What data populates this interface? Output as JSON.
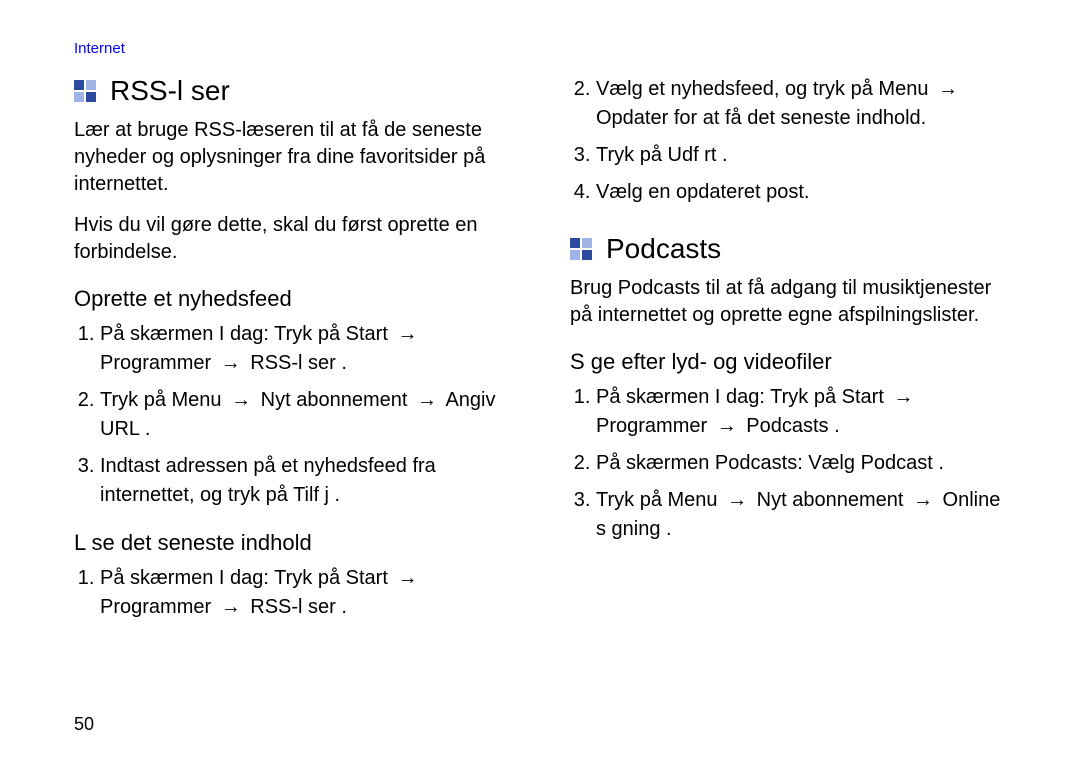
{
  "topcat": "Internet",
  "page_number": "50",
  "arrow": "→",
  "left": {
    "heading": "RSS-l ser",
    "intro1": "Lær at bruge RSS-læseren til at få de seneste nyheder og oplysninger fra dine favoritsider på internettet.",
    "intro2": "Hvis du vil gøre dette, skal du først oprette en forbindelse.",
    "section1": {
      "title": "Oprette et nyhedsfeed",
      "step1_pre": "På skærmen I dag: Tryk på ",
      "step1_a": "Start",
      "step1_b": "Programmer",
      "step1_c": "RSS-l ser",
      "step2_pre": "Tryk på ",
      "step2_a": "Menu",
      "step2_b": "Nyt abonnement",
      "step2_c": "Angiv URL",
      "step3_pre": "Indtast adressen på et nyhedsfeed fra internettet, og tryk på ",
      "step3_a": "Tilf j"
    },
    "section2": {
      "title": "L se det seneste indhold",
      "step1_pre": "På skærmen I dag: Tryk på ",
      "step1_a": "Start",
      "step1_b": "Programmer",
      "step1_c": "RSS-l ser"
    }
  },
  "right": {
    "cont_steps": {
      "step2_pre": "Vælg et nyhedsfeed, og tryk på ",
      "step2_a": "Menu",
      "step2_b": "Opdater",
      "step2_post": " for at få det seneste indhold.",
      "step3_pre": "Tryk på ",
      "step3_a": "Udf rt",
      "step4": "Vælg en opdateret post."
    },
    "heading": "Podcasts",
    "intro": "Brug Podcasts til at få adgang til musiktjenester på internettet og oprette egne afspilningslister.",
    "section1": {
      "title": "S ge efter lyd- og videofiler",
      "step1_pre": "På skærmen I dag: Tryk på ",
      "step1_a": "Start",
      "step1_b": "Programmer",
      "step1_c": "Podcasts",
      "step2_pre": "På skærmen Podcasts: Vælg ",
      "step2_a": "Podcast",
      "step3_pre": "Tryk på ",
      "step3_a": "Menu",
      "step3_b": "Nyt abonnement",
      "step3_c": "Online s gning"
    }
  }
}
